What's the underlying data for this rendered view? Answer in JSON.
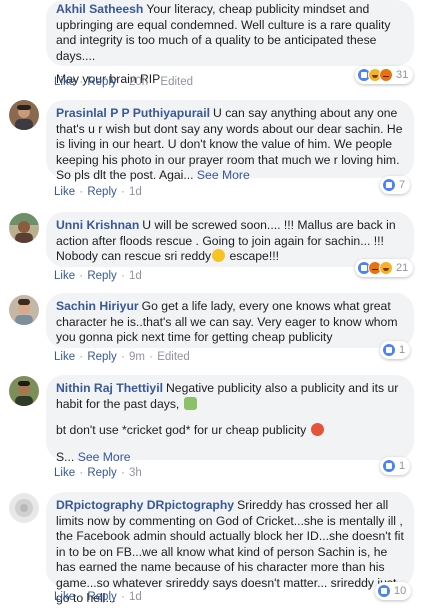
{
  "colors": {
    "link": "#385898",
    "bubble": "#f2f3f5",
    "meta": "#90949c"
  },
  "comments": [
    {
      "author": "Akhil Satheesh",
      "text": "Your literacy, cheap publicity mindset and upbringing are equal condemned. Well culture is a rare quality and integrity is too much of a quality to be anticipated these days....",
      "text2": "May your brain RIP",
      "like": "Like",
      "reply": "Reply",
      "time": "20h",
      "edited": "Edited",
      "reactions": {
        "icons": [
          "like-icon",
          "haha-icon",
          "angry-icon"
        ],
        "count": "31"
      }
    },
    {
      "author": "Prasinlal P P Puthiyapurail",
      "text": "U can say anything about any one that's u r wish but dont say any words about our dear sachin. He is living in our heart. U don't know the value of him. We people keeping his photo in our prayer room that much we r loving him. So pls dlt the post. Agai...",
      "see_more": "See More",
      "like": "Like",
      "reply": "Reply",
      "time": "1d",
      "reactions": {
        "icons": [
          "like-icon"
        ],
        "count": "7"
      }
    },
    {
      "author": "Unni Krishnan",
      "text": "U will be screwed soon.... !!! Mallus are back in action after floods rescue . Going to join again for sachin... !!! Nobody can rescue sri reddy",
      "text_after_emoji": "escape!!!",
      "emoji": "laughing-emoji-icon",
      "like": "Like",
      "reply": "Reply",
      "time": "1d",
      "reactions": {
        "icons": [
          "like-icon",
          "angry-icon",
          "haha-icon"
        ],
        "count": "21"
      }
    },
    {
      "author": "Sachin Hiriyur",
      "text": "Go get a life lady, every one knows what great character he is..that's all we can say. Very eager to know whom you gonna pick next time for getting cheap publicity",
      "like": "Like",
      "reply": "Reply",
      "time": "9m",
      "edited": "Edited",
      "reactions": {
        "icons": [
          "like-icon"
        ],
        "count": "1"
      }
    },
    {
      "author": "Nithin Raj Thettiyil",
      "text": "Negative publicity also a publicity and its ur habit for the past days,",
      "emoji1": "zombie-emoji-icon",
      "text2": "bt don't use *cricket god* for ur cheap publicity",
      "emoji2": "angry-emoji-icon",
      "text3": "S...",
      "see_more": "See More",
      "like": "Like",
      "reply": "Reply",
      "time": "3h",
      "reactions": {
        "icons": [
          "like-icon"
        ],
        "count": "1"
      }
    },
    {
      "author": "DRpictography DRpictography",
      "text": "Srireddy has crossed her all limits now by commenting on God of Cricket...she is mentally ill , the Facebook admin should actually block her ID...she doesn't fit in to be on FB...we all know what kind of person Sachin is, he has earned the name because of his character more than his game...so whatever srireddy says doesn't matter... srireddy just go to hell...",
      "like": "Like",
      "reply": "Reply",
      "time": "1d",
      "reactions": {
        "icons": [
          "like-icon"
        ],
        "count": "10"
      }
    }
  ]
}
